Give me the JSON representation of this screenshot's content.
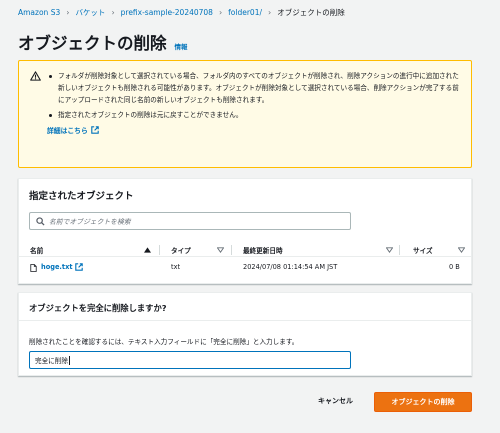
{
  "breadcrumb": {
    "items": [
      "Amazon S3",
      "バケット",
      "prefix-sample-20240708",
      "folder01/"
    ],
    "current": "オブジェクトの削除"
  },
  "page": {
    "title": "オブジェクトの削除",
    "info_link": "情報"
  },
  "warning": {
    "icon": "warning-icon",
    "messages": [
      "フォルダが削除対象として選択されている場合、フォルダ内のすべてのオブジェクトが削除され、削除アクションの進行中に追加された新しいオブジェクトも削除される可能性があります。オブジェクトが削除対象として選択されている場合、削除アクションが完了する前にアップロードされた同じ名前の新しいオブジェクトも削除されます。",
      "指定されたオブジェクトの削除は元に戻すことができません。"
    ],
    "details_link": "詳細はこちら"
  },
  "objects_panel": {
    "title": "指定されたオブジェクト",
    "search_placeholder": "名前でオブジェクトを検索",
    "columns": [
      "名前",
      "タイプ",
      "最終更新日時",
      "サイズ"
    ],
    "rows": [
      {
        "name": "hoge.txt",
        "type": "txt",
        "modified": "2024/07/08 01:14:54 AM JST",
        "size": "0 B"
      }
    ]
  },
  "confirm_panel": {
    "title": "オブジェクトを完全に削除しますか?",
    "description": "削除されたことを確認するには、テキスト入力フィールドに「完全に削除」と入力します。",
    "input_value": "完全に削除"
  },
  "actions": {
    "cancel": "キャンセル",
    "delete": "オブジェクトの削除"
  },
  "colors": {
    "link": "#0073bb",
    "primary_button": "#ec7211",
    "warning_border": "#ffbc00",
    "warning_bg": "#fffbe6"
  }
}
